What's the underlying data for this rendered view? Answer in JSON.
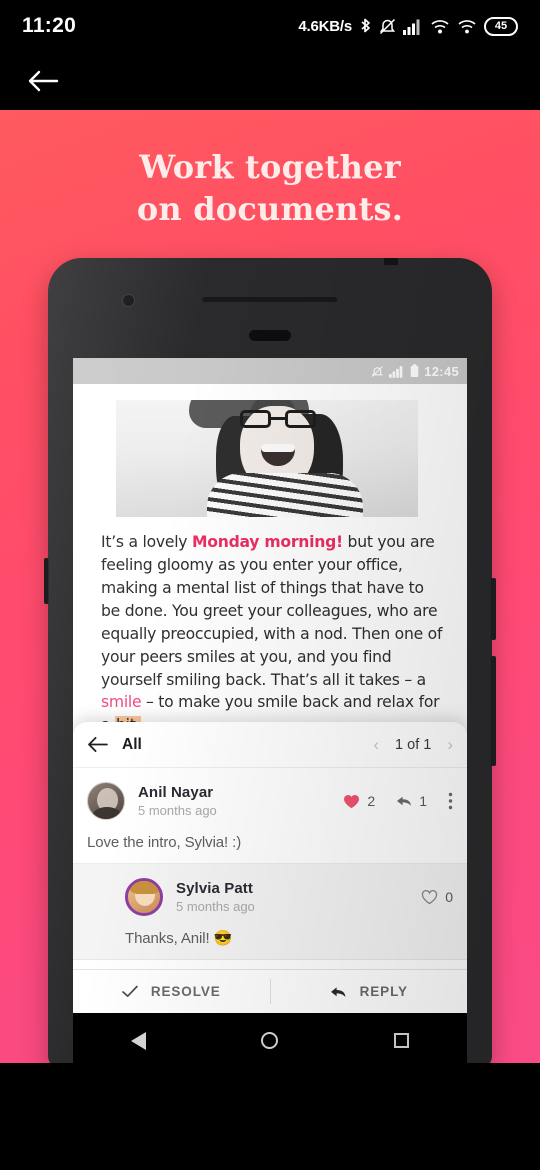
{
  "os_status": {
    "clock": "11:20",
    "network_speed": "4.6KB/s",
    "battery_level": "45",
    "icons": [
      "bluetooth-icon",
      "mute-icon",
      "cellular-signal-icon",
      "wifi-calling-icon",
      "wifi-icon",
      "battery-icon"
    ]
  },
  "appbar": {
    "back_label": "back-arrow"
  },
  "promo": {
    "headline_line1": "Work together",
    "headline_line2": "on documents.",
    "background_color": "#ff4f6b"
  },
  "phone": {
    "inner_status": {
      "time": "12:45",
      "icons": [
        "mute-icon",
        "signal-icon",
        "battery-icon"
      ]
    },
    "document": {
      "photo_alt": "smiling-girl-photo",
      "paragraph": {
        "part1": "It’s a lovely ",
        "highlight1": "Monday morning!",
        "part2": " but you are feeling gloomy as you enter your office, making a mental list of things that have to be done. You greet your colleagues, who are equally preoccupied, with a nod. Then one of your peers smiles at you, and you find yourself smiling back. That’s all it takes – a ",
        "highlight2": "smile",
        "part3": " – to make you smile back and relax for a ",
        "highlight3": "bit.",
        "colors": {
          "pink": "#ee2e62",
          "orange_highlight": "#fcc89a"
        }
      }
    },
    "comment_sheet": {
      "filter_label": "All",
      "pager": {
        "prev": "‹",
        "label": "1 of 1",
        "next": "›"
      },
      "comments": [
        {
          "author": "Anil Nayar",
          "time": "5 months ago",
          "body": "Love the intro, Sylvia! :)",
          "like_count": "2",
          "reply_count": "1",
          "liked": true,
          "is_reply": false
        },
        {
          "author": "Sylvia Patt",
          "time": "5 months ago",
          "body": "Thanks, Anil! 😎",
          "like_count": "0",
          "liked": false,
          "is_reply": true
        }
      ],
      "actions": {
        "resolve": "RESOLVE",
        "reply": "REPLY"
      }
    },
    "nav": [
      "back-nav-button",
      "home-nav-button",
      "recents-nav-button"
    ]
  }
}
